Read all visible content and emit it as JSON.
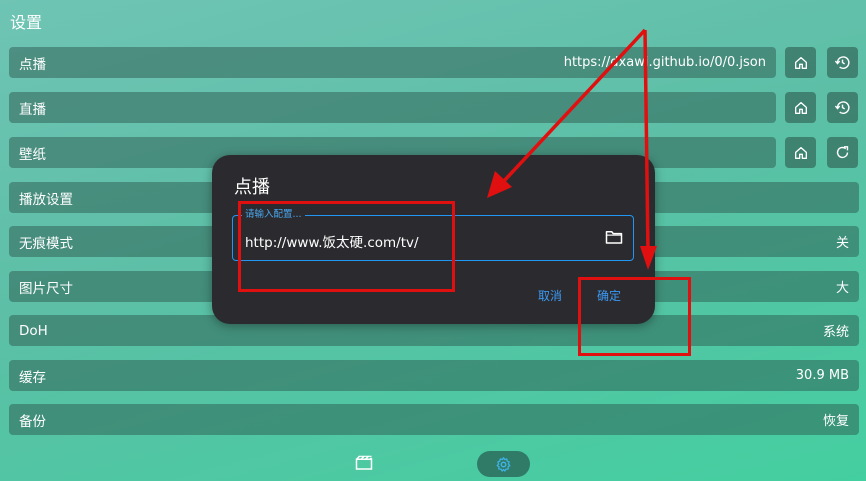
{
  "page": {
    "title": "设置"
  },
  "settings": {
    "vod": {
      "label": "点播",
      "value": "https://dxawi.github.io/0/0.json"
    },
    "live": {
      "label": "直播"
    },
    "wallpaper": {
      "label": "壁纸"
    },
    "playback": {
      "label": "播放设置"
    },
    "incognito": {
      "label": "无痕模式",
      "value": "关"
    },
    "image_size": {
      "label": "图片尺寸",
      "value": "大"
    },
    "doh": {
      "label": "DoH",
      "value": "系统"
    },
    "cache": {
      "label": "缓存",
      "value": "30.9 MB"
    },
    "backup": {
      "label": "备份",
      "value": "恢复"
    }
  },
  "dialog": {
    "title": "点播",
    "input_label": "请输入配置...",
    "input_value": "http://www.饭太硬.com/tv/",
    "cancel": "取消",
    "confirm": "确定"
  },
  "icons": {
    "home": "home-icon",
    "history": "history-icon",
    "refresh": "refresh-icon",
    "folder": "folder-icon",
    "film": "film-icon",
    "gear": "gear-icon"
  },
  "annotation_color": "#e01010"
}
